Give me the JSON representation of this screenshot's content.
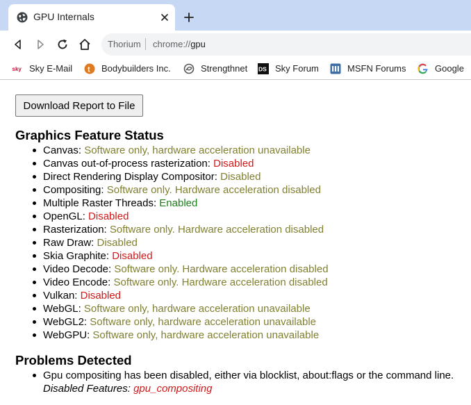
{
  "tab": {
    "title": "GPU Internals"
  },
  "omnibox": {
    "site_label": "Thorium",
    "url_scheme": "chrome://",
    "url_host": "gpu"
  },
  "bookmarks": [
    {
      "label": "Sky E-Mail",
      "icon": "sky-icon"
    },
    {
      "label": "Bodybuilders Inc.",
      "icon": "t-icon"
    },
    {
      "label": "Strengthnet",
      "icon": "swirl-icon"
    },
    {
      "label": "Sky Forum",
      "icon": "ds-icon"
    },
    {
      "label": "MSFN Forums",
      "icon": "msfn-icon"
    },
    {
      "label": "Google",
      "icon": "google-icon"
    }
  ],
  "page": {
    "download_label": "Download Report to File",
    "feature_status_title": "Graphics Feature Status",
    "features": [
      {
        "name": "Canvas: ",
        "status": "Software only, hardware acceleration unavailable",
        "tone": "olive"
      },
      {
        "name": "Canvas out-of-process rasterization: ",
        "status": "Disabled",
        "tone": "red"
      },
      {
        "name": "Direct Rendering Display Compositor: ",
        "status": "Disabled",
        "tone": "olive"
      },
      {
        "name": "Compositing: ",
        "status": "Software only. Hardware acceleration disabled",
        "tone": "olive"
      },
      {
        "name": "Multiple Raster Threads: ",
        "status": "Enabled",
        "tone": "green"
      },
      {
        "name": "OpenGL: ",
        "status": "Disabled",
        "tone": "red"
      },
      {
        "name": "Rasterization: ",
        "status": "Software only. Hardware acceleration disabled",
        "tone": "olive"
      },
      {
        "name": "Raw Draw: ",
        "status": "Disabled",
        "tone": "olive"
      },
      {
        "name": "Skia Graphite: ",
        "status": "Disabled",
        "tone": "red"
      },
      {
        "name": "Video Decode: ",
        "status": "Software only. Hardware acceleration disabled",
        "tone": "olive"
      },
      {
        "name": "Video Encode: ",
        "status": "Software only. Hardware acceleration disabled",
        "tone": "olive"
      },
      {
        "name": "Vulkan: ",
        "status": "Disabled",
        "tone": "red"
      },
      {
        "name": "WebGL: ",
        "status": "Software only, hardware acceleration unavailable",
        "tone": "olive"
      },
      {
        "name": "WebGL2: ",
        "status": "Software only, hardware acceleration unavailable",
        "tone": "olive"
      },
      {
        "name": "WebGPU: ",
        "status": "Software only, hardware acceleration unavailable",
        "tone": "olive"
      }
    ],
    "problems_title": "Problems Detected",
    "problems": [
      {
        "description": "Gpu compositing has been disabled, either via blocklist, about:flags or the command line.",
        "disabled_features_label": "Disabled Features: ",
        "disabled_features_value": "gpu_compositing"
      }
    ]
  },
  "colors": {
    "tabstrip": "#c7d8f5",
    "status_olive": "#808030",
    "status_red": "#d31818",
    "status_green": "#1a801a"
  }
}
